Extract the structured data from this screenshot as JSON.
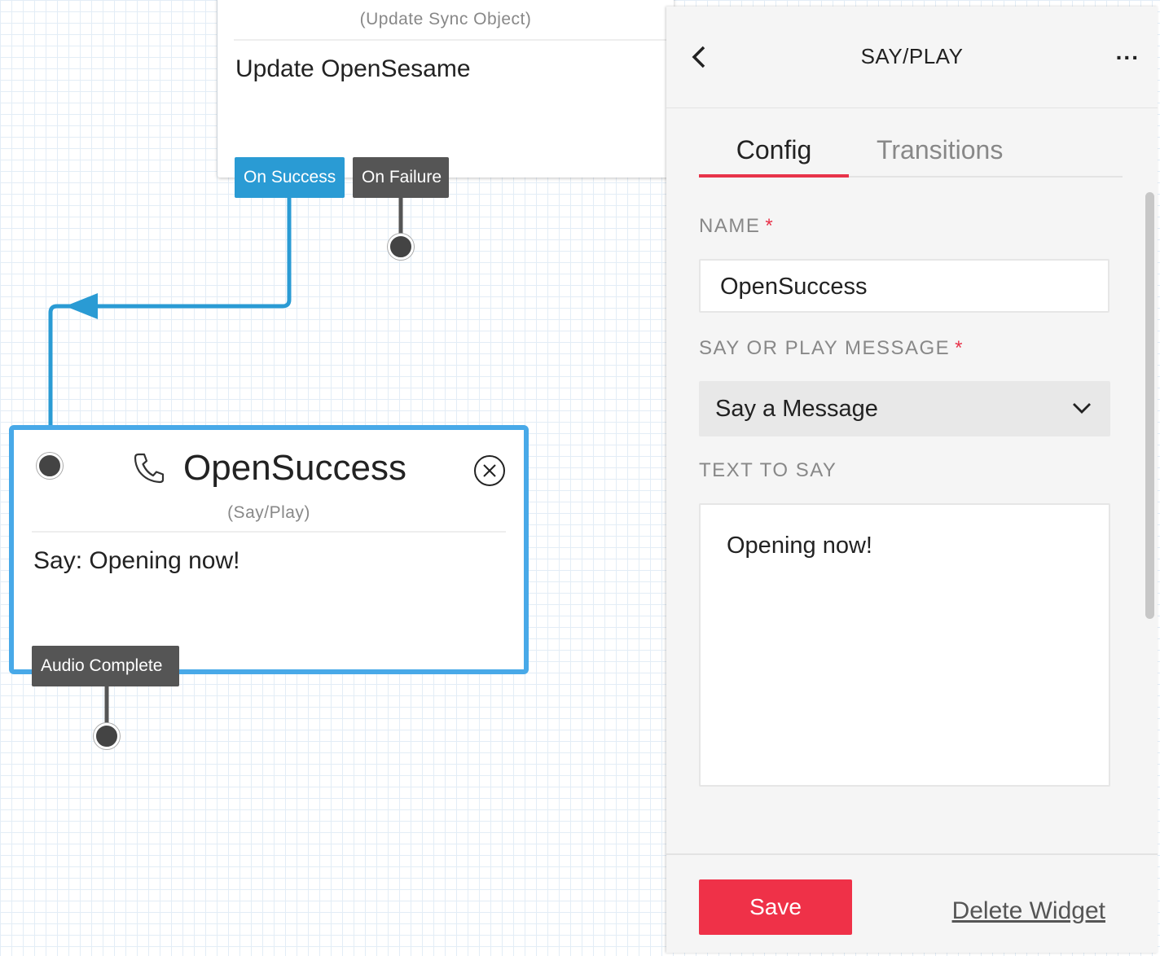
{
  "canvas": {
    "top_widget": {
      "subtitle": "(Update Sync Object)",
      "body": "Update OpenSesame",
      "transitions": {
        "success": "On Success",
        "failure": "On Failure"
      }
    },
    "selected_widget": {
      "icon": "phone-icon",
      "title": "OpenSuccess",
      "subtitle": "(Say/Play)",
      "body": "Say: Opening now!",
      "transitions": {
        "audio_complete": "Audio Complete"
      }
    },
    "colors": {
      "selected_border": "#48a9e8",
      "success_tag": "#2a9bd4",
      "neutral_tag": "#555555"
    }
  },
  "panel": {
    "title": "SAY/PLAY",
    "more": "...",
    "tabs": [
      {
        "label": "Config",
        "active": true
      },
      {
        "label": "Transitions",
        "active": false
      }
    ],
    "fields": {
      "name": {
        "label": "NAME",
        "required": "*",
        "value": "OpenSuccess"
      },
      "message_type": {
        "label": "SAY OR PLAY MESSAGE",
        "required": "*",
        "value": "Say a Message"
      },
      "text_to_say": {
        "label": "TEXT TO SAY",
        "value": "Opening now!"
      }
    },
    "save_label": "Save",
    "delete_label": "Delete Widget",
    "accent_color": "#ef3148"
  }
}
